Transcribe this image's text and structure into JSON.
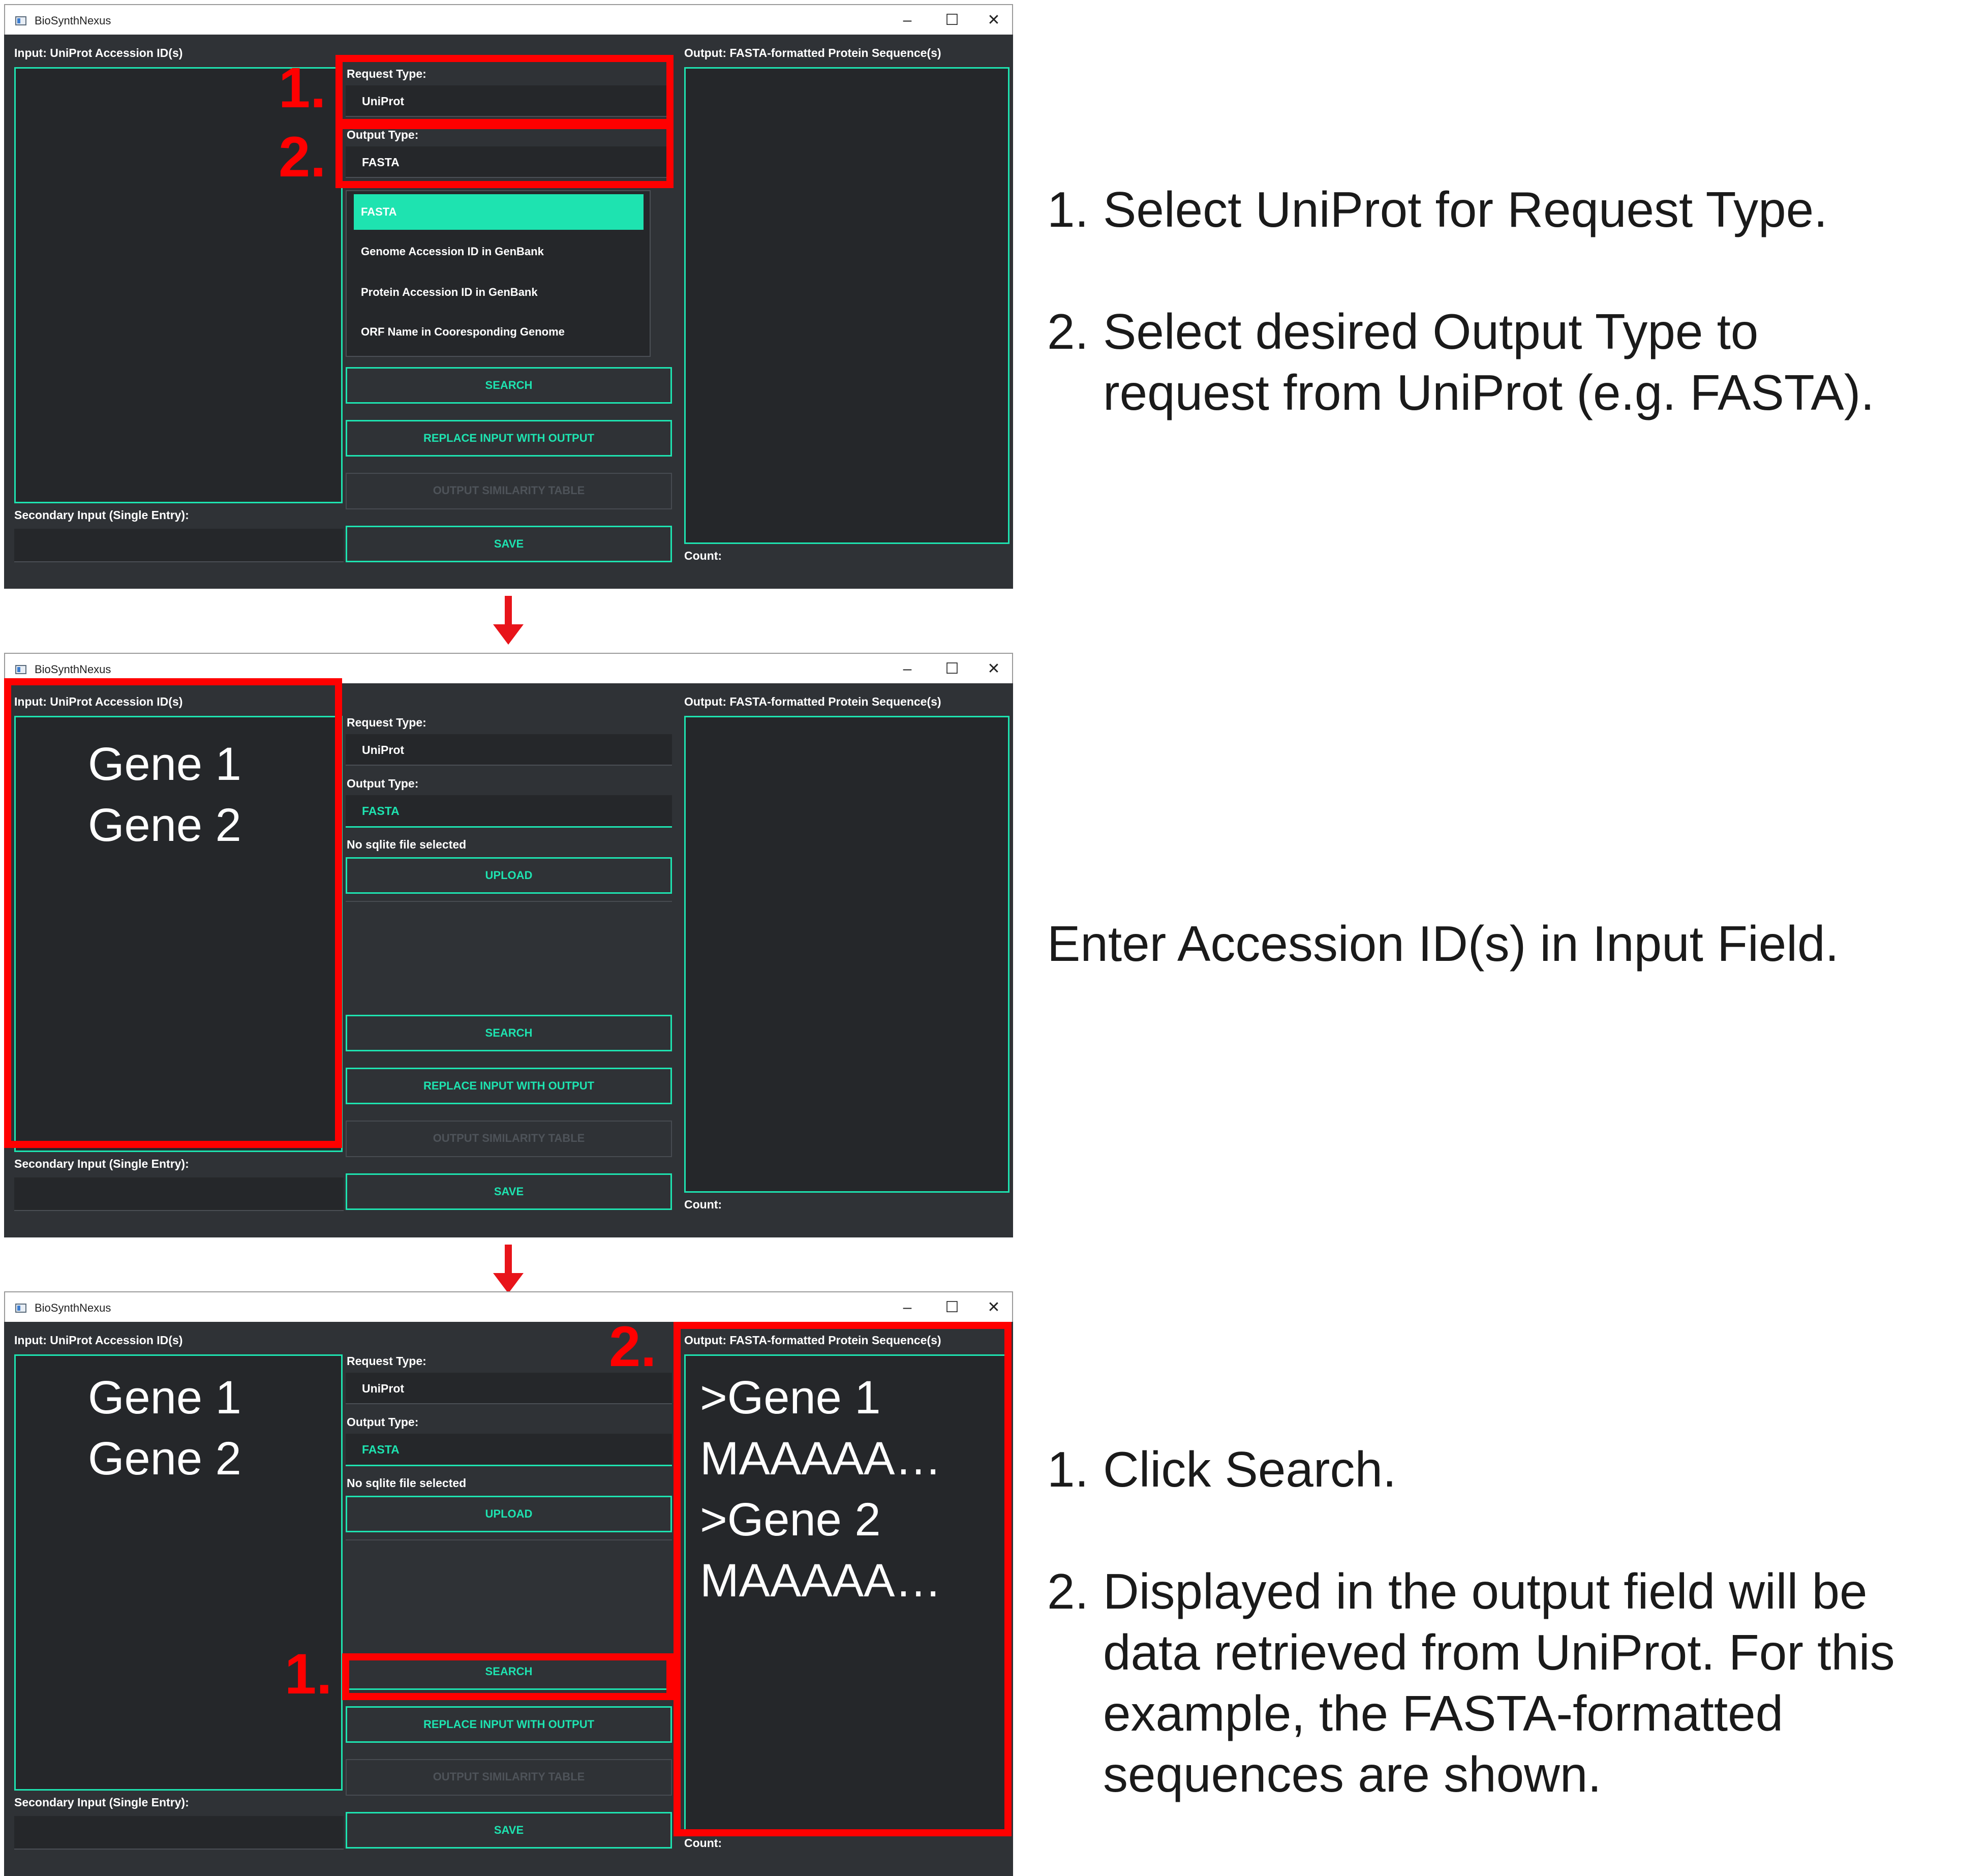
{
  "window": {
    "title": "BioSynthNexus",
    "minimize": "–",
    "maximize": "☐",
    "close": "✕"
  },
  "labels": {
    "input": "Input: UniProt Accession ID(s)",
    "output": "Output: FASTA-formatted Protein Sequence(s)",
    "request_type": "Request Type:",
    "output_type": "Output Type:",
    "secondary_input": "Secondary Input (Single Entry):",
    "count": "Count:",
    "no_sqlite": "No sqlite file selected"
  },
  "values": {
    "request_type": "UniProt",
    "output_type": "FASTA"
  },
  "buttons": {
    "search": "SEARCH",
    "replace": "REPLACE INPUT WITH OUTPUT",
    "similarity": "OUTPUT SIMILARITY TABLE",
    "save": "SAVE",
    "upload": "UPLOAD"
  },
  "dropdown_options": [
    "FASTA",
    "Genome Accession ID in GenBank",
    "Protein Accession ID in GenBank",
    "ORF Name in Cooresponding Genome"
  ],
  "input_lines": [
    "Gene 1",
    "Gene 2"
  ],
  "output_lines": [
    ">Gene 1",
    "MAAAAA…",
    ">Gene 2",
    "MAAAAA…"
  ],
  "markers": {
    "one": "1.",
    "two": "2."
  },
  "instructions": {
    "step1": {
      "num1": "1.",
      "line1": "Select UniProt for Request Type.",
      "num2": "2.",
      "line2a": "Select desired Output Type to",
      "line2b": "request from UniProt (e.g. FASTA)."
    },
    "step2": {
      "line": "Enter Accession ID(s) in Input Field."
    },
    "step3": {
      "num1": "1.",
      "line1": "Click Search.",
      "num2": "2.",
      "line2a": "Displayed in the output field will be",
      "line2b": "data retrieved from UniProt. For this",
      "line2c": "example, the FASTA-formatted",
      "line2d": "sequences are shown."
    }
  }
}
